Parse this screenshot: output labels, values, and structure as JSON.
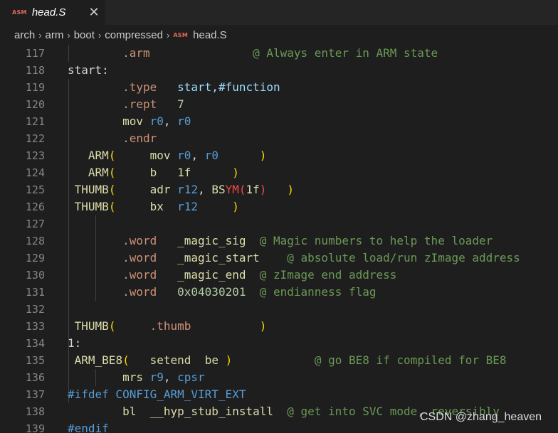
{
  "tab": {
    "badge": "ASM",
    "title": "head.S",
    "close_glyph": "✕"
  },
  "breadcrumb": {
    "items": [
      "arch",
      "arm",
      "boot",
      "compressed"
    ],
    "separator": "›",
    "file_badge": "ASM",
    "file": "head.S"
  },
  "colors": {
    "directive": "#ce9178",
    "keyword": "#569cd6",
    "label": "#dcdcaa",
    "comment": "#6a9955",
    "register": "#9cdcfe",
    "number": "#b5cea8",
    "bracket": "#ffd700",
    "red": "#f44747",
    "default": "#d4d4d4"
  },
  "code": {
    "lines": [
      {
        "num": "117",
        "tokens": [
          {
            "t": "        "
          },
          {
            "t": ".arm",
            "c": "directive"
          },
          {
            "t": "               "
          },
          {
            "t": "@ Always enter in ARM state",
            "c": "comment"
          }
        ]
      },
      {
        "num": "118",
        "tokens": [
          {
            "t": "start:",
            "c": "default"
          }
        ]
      },
      {
        "num": "119",
        "tokens": [
          {
            "t": "        "
          },
          {
            "t": ".type",
            "c": "directive"
          },
          {
            "t": "   "
          },
          {
            "t": "start,#function",
            "c": "register"
          }
        ]
      },
      {
        "num": "120",
        "tokens": [
          {
            "t": "        "
          },
          {
            "t": ".rept",
            "c": "directive"
          },
          {
            "t": "   "
          },
          {
            "t": "7",
            "c": "number"
          }
        ]
      },
      {
        "num": "121",
        "tokens": [
          {
            "t": "        "
          },
          {
            "t": "mov",
            "c": "label"
          },
          {
            "t": " "
          },
          {
            "t": "r0",
            "c": "keyword"
          },
          {
            "t": ", "
          },
          {
            "t": "r0",
            "c": "keyword"
          }
        ]
      },
      {
        "num": "122",
        "tokens": [
          {
            "t": "        "
          },
          {
            "t": ".endr",
            "c": "directive"
          }
        ]
      },
      {
        "num": "123",
        "tokens": [
          {
            "t": "   "
          },
          {
            "t": "ARM",
            "c": "label"
          },
          {
            "t": "(",
            "c": "bracket"
          },
          {
            "t": "     "
          },
          {
            "t": "mov",
            "c": "label"
          },
          {
            "t": " "
          },
          {
            "t": "r0",
            "c": "keyword"
          },
          {
            "t": ", "
          },
          {
            "t": "r0",
            "c": "keyword"
          },
          {
            "t": "      "
          },
          {
            "t": ")",
            "c": "bracket"
          }
        ]
      },
      {
        "num": "124",
        "tokens": [
          {
            "t": "   "
          },
          {
            "t": "ARM",
            "c": "label"
          },
          {
            "t": "(",
            "c": "bracket"
          },
          {
            "t": "     "
          },
          {
            "t": "b",
            "c": "label"
          },
          {
            "t": "   "
          },
          {
            "t": "1f",
            "c": "label"
          },
          {
            "t": "      "
          },
          {
            "t": ")",
            "c": "bracket"
          }
        ]
      },
      {
        "num": "125",
        "tokens": [
          {
            "t": " "
          },
          {
            "t": "THUMB",
            "c": "label"
          },
          {
            "t": "(",
            "c": "bracket"
          },
          {
            "t": "     "
          },
          {
            "t": "adr",
            "c": "label"
          },
          {
            "t": " "
          },
          {
            "t": "r12",
            "c": "keyword"
          },
          {
            "t": ", "
          },
          {
            "t": "BS",
            "c": "label"
          },
          {
            "t": "YM",
            "c": "red"
          },
          {
            "t": "(",
            "c": "red"
          },
          {
            "t": "1f",
            "c": "label"
          },
          {
            "t": ")",
            "c": "red"
          },
          {
            "t": "   "
          },
          {
            "t": ")",
            "c": "bracket"
          }
        ]
      },
      {
        "num": "126",
        "tokens": [
          {
            "t": " "
          },
          {
            "t": "THUMB",
            "c": "label"
          },
          {
            "t": "(",
            "c": "bracket"
          },
          {
            "t": "     "
          },
          {
            "t": "bx",
            "c": "label"
          },
          {
            "t": "  "
          },
          {
            "t": "r12",
            "c": "keyword"
          },
          {
            "t": "     "
          },
          {
            "t": ")",
            "c": "bracket"
          }
        ]
      },
      {
        "num": "127",
        "tokens": []
      },
      {
        "num": "128",
        "tokens": [
          {
            "t": "        "
          },
          {
            "t": ".word",
            "c": "directive"
          },
          {
            "t": "   "
          },
          {
            "t": "_magic_sig",
            "c": "label"
          },
          {
            "t": "  "
          },
          {
            "t": "@ Magic numbers to help the loader",
            "c": "comment"
          }
        ]
      },
      {
        "num": "129",
        "tokens": [
          {
            "t": "        "
          },
          {
            "t": ".word",
            "c": "directive"
          },
          {
            "t": "   "
          },
          {
            "t": "_magic_start",
            "c": "label"
          },
          {
            "t": "    "
          },
          {
            "t": "@ absolute load/run zImage address",
            "c": "comment"
          }
        ]
      },
      {
        "num": "130",
        "tokens": [
          {
            "t": "        "
          },
          {
            "t": ".word",
            "c": "directive"
          },
          {
            "t": "   "
          },
          {
            "t": "_magic_end",
            "c": "label"
          },
          {
            "t": "  "
          },
          {
            "t": "@ zImage end address",
            "c": "comment"
          }
        ]
      },
      {
        "num": "131",
        "tokens": [
          {
            "t": "        "
          },
          {
            "t": ".word",
            "c": "directive"
          },
          {
            "t": "   "
          },
          {
            "t": "0x04030201",
            "c": "number"
          },
          {
            "t": "  "
          },
          {
            "t": "@ endianness flag",
            "c": "comment"
          }
        ]
      },
      {
        "num": "132",
        "tokens": []
      },
      {
        "num": "133",
        "tokens": [
          {
            "t": " "
          },
          {
            "t": "THUMB",
            "c": "label"
          },
          {
            "t": "(",
            "c": "bracket"
          },
          {
            "t": "     "
          },
          {
            "t": ".thumb",
            "c": "directive"
          },
          {
            "t": "          "
          },
          {
            "t": ")",
            "c": "bracket"
          }
        ]
      },
      {
        "num": "134",
        "tokens": [
          {
            "t": "1:",
            "c": "default"
          }
        ]
      },
      {
        "num": "135",
        "tokens": [
          {
            "t": " "
          },
          {
            "t": "ARM_BE8",
            "c": "label"
          },
          {
            "t": "(",
            "c": "bracket"
          },
          {
            "t": "   "
          },
          {
            "t": "setend",
            "c": "label"
          },
          {
            "t": "  "
          },
          {
            "t": "be",
            "c": "label"
          },
          {
            "t": " "
          },
          {
            "t": ")",
            "c": "bracket"
          },
          {
            "t": "            "
          },
          {
            "t": "@ go BE8 if compiled for BE8",
            "c": "comment"
          }
        ]
      },
      {
        "num": "136",
        "tokens": [
          {
            "t": "        "
          },
          {
            "t": "mrs",
            "c": "label"
          },
          {
            "t": " "
          },
          {
            "t": "r9",
            "c": "keyword"
          },
          {
            "t": ", "
          },
          {
            "t": "cpsr",
            "c": "keyword"
          }
        ]
      },
      {
        "num": "137",
        "tokens": [
          {
            "t": "#ifdef CONFIG_ARM_VIRT_EXT",
            "c": "keyword"
          }
        ]
      },
      {
        "num": "138",
        "tokens": [
          {
            "t": "        "
          },
          {
            "t": "bl",
            "c": "label"
          },
          {
            "t": "  "
          },
          {
            "t": "__hyp_stub_install",
            "c": "label"
          },
          {
            "t": "  "
          },
          {
            "t": "@ get into SVC mode, reversibly",
            "c": "comment"
          }
        ]
      },
      {
        "num": "139",
        "tokens": [
          {
            "t": "#endif",
            "c": "keyword"
          }
        ]
      }
    ]
  },
  "watermark": "CSDN @zhang_heaven"
}
